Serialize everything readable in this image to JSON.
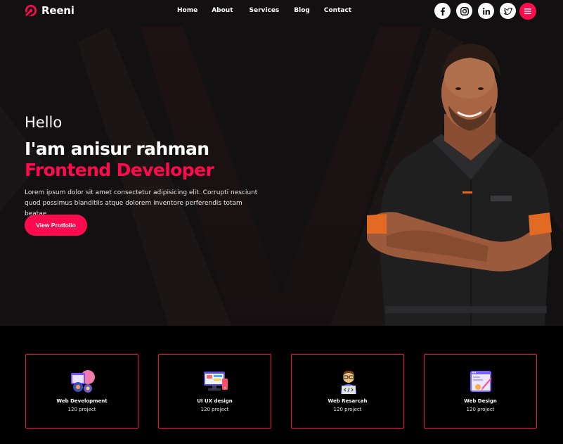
{
  "brand": {
    "name": "Reeni"
  },
  "nav": {
    "items": [
      "Home",
      "About",
      "Services",
      "Blog",
      "Contact"
    ]
  },
  "socials": [
    "facebook-icon",
    "instagram-icon",
    "linkedin-icon",
    "twitter-icon"
  ],
  "colors": {
    "accent": "#ff0a4f",
    "hero_bg": "#141213",
    "services_bg": "#000000"
  },
  "hero": {
    "greeting": "Hello",
    "name": "I'am anisur rahman",
    "role": "Frontend Developer",
    "description": "Lorem ipsum dolor sit amet consectetur adipisicing elit. Corrupti nesciunt quod possimus blanditiis atque dolorem inventore perferendis totam beatae",
    "cta": "View Protfolio"
  },
  "services": [
    {
      "title": "Web Development",
      "count": "120 project",
      "icon": "web-development-icon"
    },
    {
      "title": "UI UX design",
      "count": "120 project",
      "icon": "ui-ux-design-icon"
    },
    {
      "title": "Web Resarcah",
      "count": "120 project",
      "icon": "web-research-icon"
    },
    {
      "title": "Web Design",
      "count": "120 project",
      "icon": "web-design-icon"
    }
  ]
}
